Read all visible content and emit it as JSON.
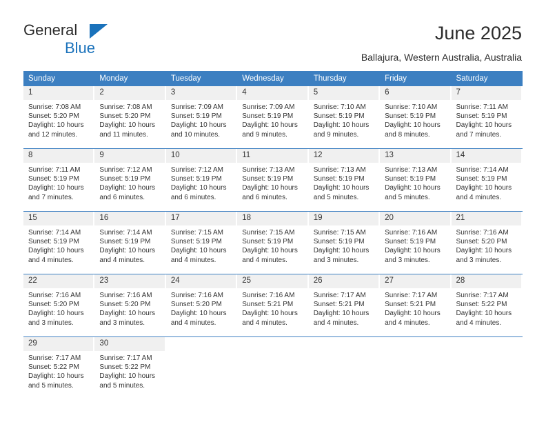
{
  "brand": {
    "name_top": "General",
    "name_bottom": "Blue",
    "triangle_color": "#1a72bb"
  },
  "header": {
    "title": "June 2025",
    "subtitle": "Ballajura, Western Australia, Australia"
  },
  "theme": {
    "header_blue": "#3c7fc1",
    "daynum_gray": "#f0f0f0",
    "text": "#333333"
  },
  "weekdays": [
    "Sunday",
    "Monday",
    "Tuesday",
    "Wednesday",
    "Thursday",
    "Friday",
    "Saturday"
  ],
  "labels": {
    "sunrise_prefix": "Sunrise: ",
    "sunset_prefix": "Sunset: ",
    "daylight_prefix": "Daylight: "
  },
  "weeks": [
    [
      {
        "day": "1",
        "sunrise": "Sunrise: 7:08 AM",
        "sunset": "Sunset: 5:20 PM",
        "daylight_1": "Daylight: 10 hours",
        "daylight_2": "and 12 minutes."
      },
      {
        "day": "2",
        "sunrise": "Sunrise: 7:08 AM",
        "sunset": "Sunset: 5:20 PM",
        "daylight_1": "Daylight: 10 hours",
        "daylight_2": "and 11 minutes."
      },
      {
        "day": "3",
        "sunrise": "Sunrise: 7:09 AM",
        "sunset": "Sunset: 5:19 PM",
        "daylight_1": "Daylight: 10 hours",
        "daylight_2": "and 10 minutes."
      },
      {
        "day": "4",
        "sunrise": "Sunrise: 7:09 AM",
        "sunset": "Sunset: 5:19 PM",
        "daylight_1": "Daylight: 10 hours",
        "daylight_2": "and 9 minutes."
      },
      {
        "day": "5",
        "sunrise": "Sunrise: 7:10 AM",
        "sunset": "Sunset: 5:19 PM",
        "daylight_1": "Daylight: 10 hours",
        "daylight_2": "and 9 minutes."
      },
      {
        "day": "6",
        "sunrise": "Sunrise: 7:10 AM",
        "sunset": "Sunset: 5:19 PM",
        "daylight_1": "Daylight: 10 hours",
        "daylight_2": "and 8 minutes."
      },
      {
        "day": "7",
        "sunrise": "Sunrise: 7:11 AM",
        "sunset": "Sunset: 5:19 PM",
        "daylight_1": "Daylight: 10 hours",
        "daylight_2": "and 7 minutes."
      }
    ],
    [
      {
        "day": "8",
        "sunrise": "Sunrise: 7:11 AM",
        "sunset": "Sunset: 5:19 PM",
        "daylight_1": "Daylight: 10 hours",
        "daylight_2": "and 7 minutes."
      },
      {
        "day": "9",
        "sunrise": "Sunrise: 7:12 AM",
        "sunset": "Sunset: 5:19 PM",
        "daylight_1": "Daylight: 10 hours",
        "daylight_2": "and 6 minutes."
      },
      {
        "day": "10",
        "sunrise": "Sunrise: 7:12 AM",
        "sunset": "Sunset: 5:19 PM",
        "daylight_1": "Daylight: 10 hours",
        "daylight_2": "and 6 minutes."
      },
      {
        "day": "11",
        "sunrise": "Sunrise: 7:13 AM",
        "sunset": "Sunset: 5:19 PM",
        "daylight_1": "Daylight: 10 hours",
        "daylight_2": "and 6 minutes."
      },
      {
        "day": "12",
        "sunrise": "Sunrise: 7:13 AM",
        "sunset": "Sunset: 5:19 PM",
        "daylight_1": "Daylight: 10 hours",
        "daylight_2": "and 5 minutes."
      },
      {
        "day": "13",
        "sunrise": "Sunrise: 7:13 AM",
        "sunset": "Sunset: 5:19 PM",
        "daylight_1": "Daylight: 10 hours",
        "daylight_2": "and 5 minutes."
      },
      {
        "day": "14",
        "sunrise": "Sunrise: 7:14 AM",
        "sunset": "Sunset: 5:19 PM",
        "daylight_1": "Daylight: 10 hours",
        "daylight_2": "and 4 minutes."
      }
    ],
    [
      {
        "day": "15",
        "sunrise": "Sunrise: 7:14 AM",
        "sunset": "Sunset: 5:19 PM",
        "daylight_1": "Daylight: 10 hours",
        "daylight_2": "and 4 minutes."
      },
      {
        "day": "16",
        "sunrise": "Sunrise: 7:14 AM",
        "sunset": "Sunset: 5:19 PM",
        "daylight_1": "Daylight: 10 hours",
        "daylight_2": "and 4 minutes."
      },
      {
        "day": "17",
        "sunrise": "Sunrise: 7:15 AM",
        "sunset": "Sunset: 5:19 PM",
        "daylight_1": "Daylight: 10 hours",
        "daylight_2": "and 4 minutes."
      },
      {
        "day": "18",
        "sunrise": "Sunrise: 7:15 AM",
        "sunset": "Sunset: 5:19 PM",
        "daylight_1": "Daylight: 10 hours",
        "daylight_2": "and 4 minutes."
      },
      {
        "day": "19",
        "sunrise": "Sunrise: 7:15 AM",
        "sunset": "Sunset: 5:19 PM",
        "daylight_1": "Daylight: 10 hours",
        "daylight_2": "and 3 minutes."
      },
      {
        "day": "20",
        "sunrise": "Sunrise: 7:16 AM",
        "sunset": "Sunset: 5:19 PM",
        "daylight_1": "Daylight: 10 hours",
        "daylight_2": "and 3 minutes."
      },
      {
        "day": "21",
        "sunrise": "Sunrise: 7:16 AM",
        "sunset": "Sunset: 5:20 PM",
        "daylight_1": "Daylight: 10 hours",
        "daylight_2": "and 3 minutes."
      }
    ],
    [
      {
        "day": "22",
        "sunrise": "Sunrise: 7:16 AM",
        "sunset": "Sunset: 5:20 PM",
        "daylight_1": "Daylight: 10 hours",
        "daylight_2": "and 3 minutes."
      },
      {
        "day": "23",
        "sunrise": "Sunrise: 7:16 AM",
        "sunset": "Sunset: 5:20 PM",
        "daylight_1": "Daylight: 10 hours",
        "daylight_2": "and 3 minutes."
      },
      {
        "day": "24",
        "sunrise": "Sunrise: 7:16 AM",
        "sunset": "Sunset: 5:20 PM",
        "daylight_1": "Daylight: 10 hours",
        "daylight_2": "and 4 minutes."
      },
      {
        "day": "25",
        "sunrise": "Sunrise: 7:16 AM",
        "sunset": "Sunset: 5:21 PM",
        "daylight_1": "Daylight: 10 hours",
        "daylight_2": "and 4 minutes."
      },
      {
        "day": "26",
        "sunrise": "Sunrise: 7:17 AM",
        "sunset": "Sunset: 5:21 PM",
        "daylight_1": "Daylight: 10 hours",
        "daylight_2": "and 4 minutes."
      },
      {
        "day": "27",
        "sunrise": "Sunrise: 7:17 AM",
        "sunset": "Sunset: 5:21 PM",
        "daylight_1": "Daylight: 10 hours",
        "daylight_2": "and 4 minutes."
      },
      {
        "day": "28",
        "sunrise": "Sunrise: 7:17 AM",
        "sunset": "Sunset: 5:22 PM",
        "daylight_1": "Daylight: 10 hours",
        "daylight_2": "and 4 minutes."
      }
    ],
    [
      {
        "day": "29",
        "sunrise": "Sunrise: 7:17 AM",
        "sunset": "Sunset: 5:22 PM",
        "daylight_1": "Daylight: 10 hours",
        "daylight_2": "and 5 minutes."
      },
      {
        "day": "30",
        "sunrise": "Sunrise: 7:17 AM",
        "sunset": "Sunset: 5:22 PM",
        "daylight_1": "Daylight: 10 hours",
        "daylight_2": "and 5 minutes."
      },
      {
        "day": "",
        "sunrise": "",
        "sunset": "",
        "daylight_1": "",
        "daylight_2": ""
      },
      {
        "day": "",
        "sunrise": "",
        "sunset": "",
        "daylight_1": "",
        "daylight_2": ""
      },
      {
        "day": "",
        "sunrise": "",
        "sunset": "",
        "daylight_1": "",
        "daylight_2": ""
      },
      {
        "day": "",
        "sunrise": "",
        "sunset": "",
        "daylight_1": "",
        "daylight_2": ""
      },
      {
        "day": "",
        "sunrise": "",
        "sunset": "",
        "daylight_1": "",
        "daylight_2": ""
      }
    ]
  ]
}
